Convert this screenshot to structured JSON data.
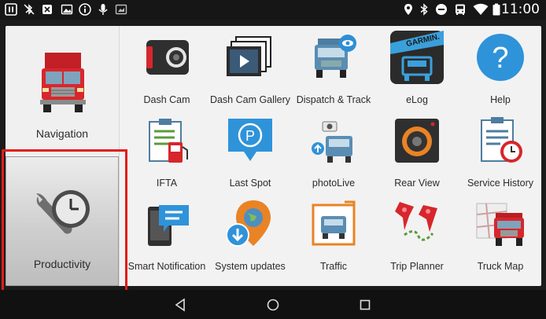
{
  "status": {
    "time": "11:00"
  },
  "sidebar": {
    "items": [
      {
        "label": "Navigation"
      },
      {
        "label": "Productivity"
      }
    ]
  },
  "apps": [
    {
      "label": "Dash Cam",
      "icon": "dash-cam-icon"
    },
    {
      "label": "Dash Cam Gallery",
      "icon": "dash-cam-gallery-icon"
    },
    {
      "label": "Dispatch & Track",
      "icon": "dispatch-track-icon"
    },
    {
      "label": "eLog",
      "icon": "elog-icon",
      "brand": "GARMIN"
    },
    {
      "label": "Help",
      "icon": "help-icon"
    },
    {
      "label": "IFTA",
      "icon": "ifta-icon"
    },
    {
      "label": "Last Spot",
      "icon": "last-spot-icon"
    },
    {
      "label": "photoLive",
      "icon": "photolive-icon"
    },
    {
      "label": "Rear View",
      "icon": "rear-view-icon"
    },
    {
      "label": "Service History",
      "icon": "service-history-icon"
    },
    {
      "label": "Smart Notification",
      "icon": "smart-notification-icon"
    },
    {
      "label": "System updates",
      "icon": "system-updates-icon"
    },
    {
      "label": "Traffic",
      "icon": "traffic-icon"
    },
    {
      "label": "Trip Planner",
      "icon": "trip-planner-icon"
    },
    {
      "label": "Truck Map",
      "icon": "truck-map-icon"
    }
  ],
  "colors": {
    "highlight": "#e21b1b",
    "accent_blue": "#2d8fd5",
    "truck_red": "#d9262c"
  }
}
